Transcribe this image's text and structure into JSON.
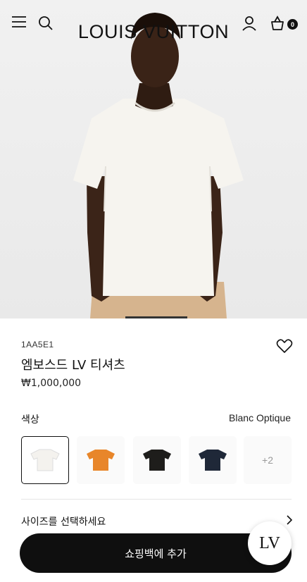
{
  "header": {
    "brand": "LOUIS VUITTON",
    "cart_count": "0",
    "icons": [
      "menu-icon",
      "search-icon",
      "account-icon",
      "shopping-bag-icon"
    ]
  },
  "product": {
    "sku": "1AA5E1",
    "name": "엠보스드 LV 티셔츠",
    "price": "₩1,000,000"
  },
  "color": {
    "label": "색상",
    "selected": "Blanc Optique",
    "swatches": [
      {
        "name": "white",
        "hex": "#f4f2ee"
      },
      {
        "name": "orange",
        "hex": "#e8862a"
      },
      {
        "name": "black",
        "hex": "#1e1d1b"
      },
      {
        "name": "navy",
        "hex": "#1f2838"
      }
    ],
    "more_label": "+2"
  },
  "size": {
    "label": "사이즈를 선택하세요"
  },
  "actions": {
    "add_to_bag": "쇼핑백에 추가",
    "lv_chat": "LV"
  },
  "colors": {
    "primary": "#111111",
    "hero_bg": "#ececec"
  }
}
